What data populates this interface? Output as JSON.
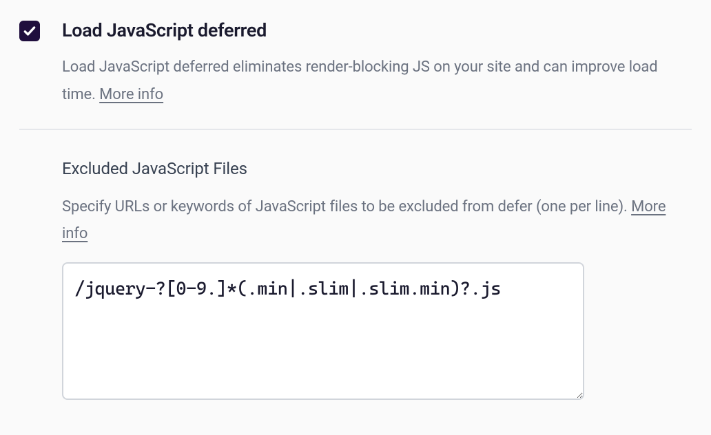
{
  "defer_setting": {
    "checked": true,
    "title": "Load JavaScript deferred",
    "description": "Load JavaScript deferred eliminates render-blocking JS on your site and can improve load time. ",
    "more_info_label": "More info"
  },
  "excluded_setting": {
    "title": "Excluded JavaScript Files",
    "description": "Specify URLs or keywords of JavaScript files to be excluded from defer (one per line). ",
    "more_info_label": "More info",
    "textarea_value": "/jquery-?[0-9.]*(.min|.slim|.slim.min)?.js"
  }
}
